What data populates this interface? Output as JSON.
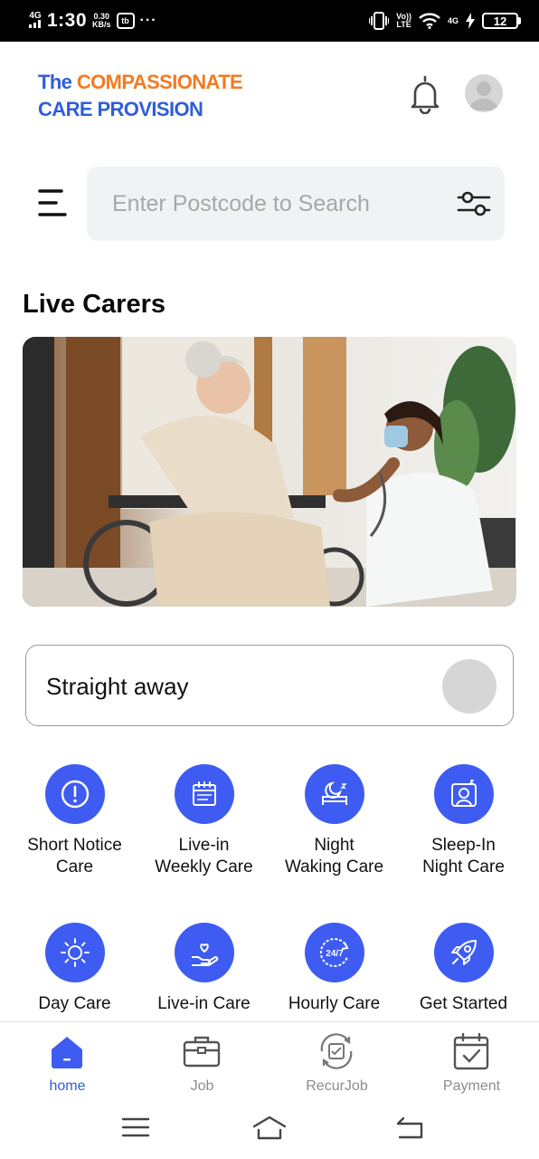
{
  "status_bar": {
    "network": "4G",
    "time": "1:30",
    "speed_value": "0.30",
    "speed_unit": "KB/s",
    "app_badge": "tb",
    "more": "···",
    "volte_top": "Vo))",
    "volte_bottom": "LTE",
    "network2": "4G",
    "battery": "12"
  },
  "header": {
    "brand_line1_a": "The ",
    "brand_line1_b": "COMPASSIONATE",
    "brand_line2": "CARE PROVISION",
    "brand_colors": {
      "blue": "#2f5fd6",
      "orange": "#f27b22"
    },
    "notification_icon": "bell-icon",
    "profile_icon": "user-avatar-icon"
  },
  "search": {
    "menu_icon": "hamburger-menu-icon",
    "placeholder": "Enter Postcode to Search",
    "value": "",
    "filter_icon": "filter-sliders-icon"
  },
  "section_title": "Live Carers",
  "hero": {
    "image_icon": "carer-with-elderly-woman-photo"
  },
  "straight_away": {
    "label": "Straight away",
    "toggle_on": false
  },
  "services": [
    {
      "line1": "Short Notice",
      "line2": "Care",
      "icon": "alert-circle-icon"
    },
    {
      "line1": "Live-in",
      "line2": "Weekly Care",
      "icon": "calendar-icon"
    },
    {
      "line1": "Night",
      "line2": "Waking Care",
      "icon": "moon-bed-icon"
    },
    {
      "line1": "Sleep-In",
      "line2": "Night Care",
      "icon": "sleeping-person-icon"
    },
    {
      "line1": "Day Care",
      "line2": "",
      "icon": "sun-icon"
    },
    {
      "line1": "Live-in Care",
      "line2": "",
      "icon": "heart-hand-icon"
    },
    {
      "line1": "Hourly Care",
      "line2": "",
      "icon": "clock-24-7-icon"
    },
    {
      "line1": "Get Started",
      "line2": "",
      "icon": "rocket-icon"
    }
  ],
  "service_color": "#3e5cf2",
  "bottom_nav": [
    {
      "label": "home",
      "icon": "home-icon",
      "active": true
    },
    {
      "label": "Job",
      "icon": "briefcase-icon",
      "active": false
    },
    {
      "label": "RecurJob",
      "icon": "recurring-calendar-icon",
      "active": false
    },
    {
      "label": "Payment",
      "icon": "calendar-check-icon",
      "active": false
    }
  ],
  "system_nav": [
    "menu-icon",
    "home-icon",
    "back-icon"
  ]
}
